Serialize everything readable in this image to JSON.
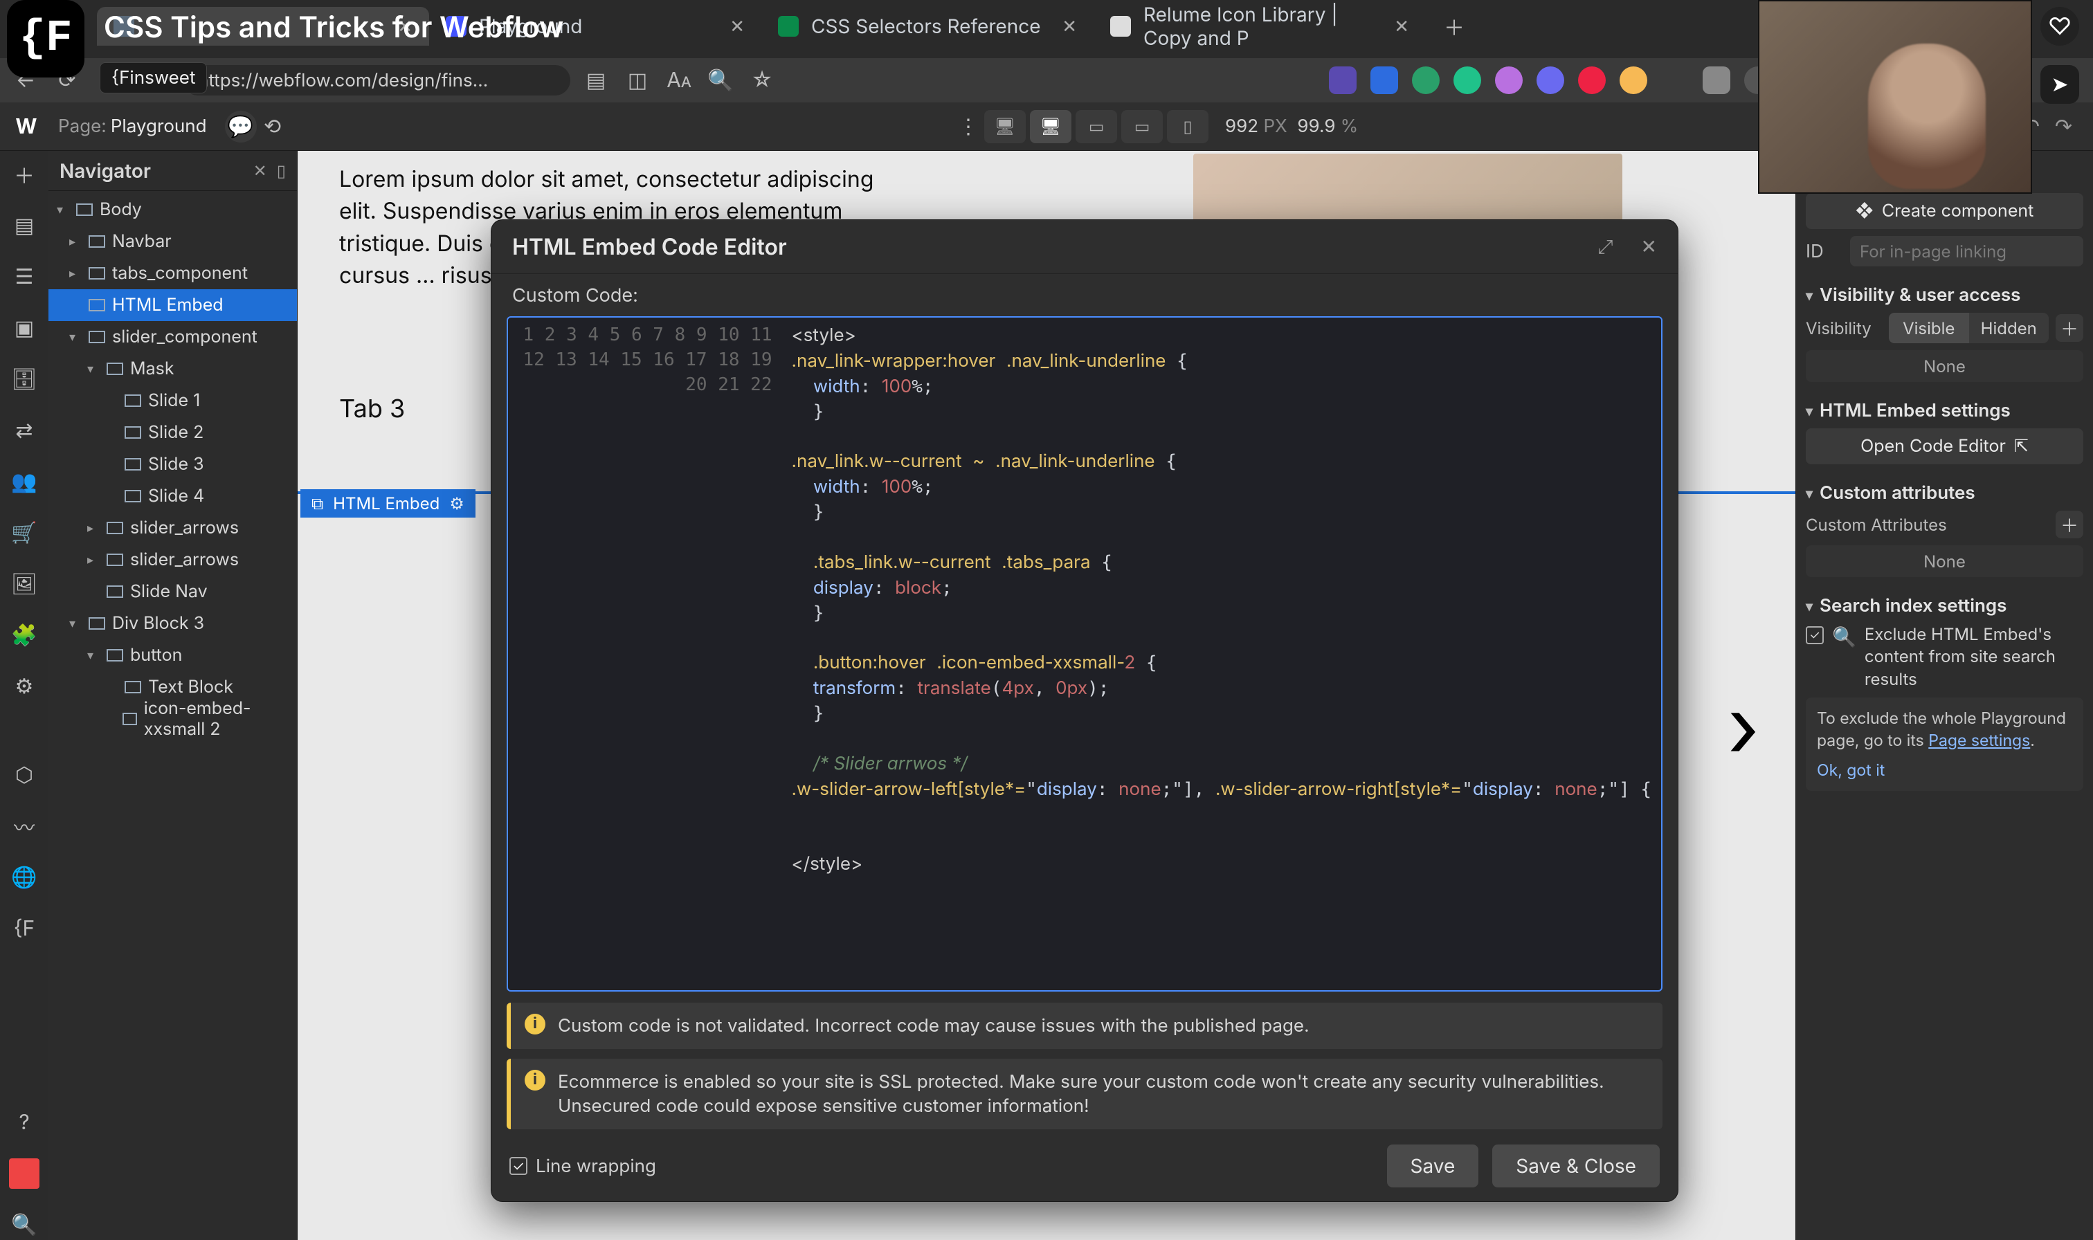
{
  "video_title": "CSS Tips and Tricks for Webflow",
  "fs_tooltip": "{Finsweet",
  "browser_tabs": [
    {
      "label": "",
      "active": false
    },
    {
      "label": "Playground",
      "active": false
    },
    {
      "label": "CSS Selectors Reference",
      "active": false
    },
    {
      "label": "Relume Icon Library | Copy and P",
      "active": false
    }
  ],
  "address_url": "https://webflow.com/design/fins…",
  "wf": {
    "page_label": "Page:",
    "page_name": "Playground",
    "px_value": "992",
    "px_unit": "PX",
    "zoom": "99.9",
    "zoom_unit": "%"
  },
  "navigator": {
    "title": "Navigator",
    "tree": [
      {
        "lvl": 0,
        "label": "Body",
        "caret": "▾"
      },
      {
        "lvl": 1,
        "label": "Navbar",
        "caret": "▸"
      },
      {
        "lvl": 1,
        "label": "tabs_component",
        "caret": "▸"
      },
      {
        "lvl": 1,
        "label": "HTML Embed",
        "caret": "",
        "sel": true
      },
      {
        "lvl": 1,
        "label": "slider_component",
        "caret": "▾"
      },
      {
        "lvl": 2,
        "label": "Mask",
        "caret": "▾"
      },
      {
        "lvl": 3,
        "label": "Slide 1",
        "caret": ""
      },
      {
        "lvl": 3,
        "label": "Slide 2",
        "caret": ""
      },
      {
        "lvl": 3,
        "label": "Slide 3",
        "caret": ""
      },
      {
        "lvl": 3,
        "label": "Slide 4",
        "caret": ""
      },
      {
        "lvl": 2,
        "label": "slider_arrows",
        "caret": "▸"
      },
      {
        "lvl": 2,
        "label": "slider_arrows",
        "caret": "▸"
      },
      {
        "lvl": 2,
        "label": "Slide Nav",
        "caret": ""
      },
      {
        "lvl": 1,
        "label": "Div Block 3",
        "caret": "▾"
      },
      {
        "lvl": 2,
        "label": "button",
        "caret": "▾"
      },
      {
        "lvl": 3,
        "label": "Text Block",
        "caret": ""
      },
      {
        "lvl": 3,
        "label": "icon-embed-xxsmall 2",
        "caret": ""
      }
    ]
  },
  "canvas": {
    "lorem": "Lorem ipsum dolor sit amet, consectetur adipiscing elit. Suspendisse varius enim in eros elementum tristique. Duis cursus, mi …\ncommodo …\njusto cursus …\nrisus tristique …",
    "tab3": "Tab 3",
    "embed_badge": "HTML Embed"
  },
  "modal": {
    "title": "HTML Embed Code Editor",
    "subtitle": "Custom Code:",
    "code_lines": [
      "<style>",
      ".nav_link-wrapper:hover .nav_link-underline {",
      "  width: 100%;",
      "  }",
      "",
      ".nav_link.w--current ~ .nav_link-underline {",
      "  width: 100%;",
      "  }",
      "",
      "  .tabs_link.w--current .tabs_para {",
      "  display: block;",
      "  }",
      "",
      "  .button:hover .icon-embed-xxsmall-2 {",
      "  transform: translate(4px, 0px);",
      "  }",
      "",
      "  /* Slider arrwos */",
      ".w-slider-arrow-left[style*=\"display: none;\"], .w-slider-arrow-right[style*=\"display: none;\"] {",
      "",
      "",
      "</style>"
    ],
    "warn1": "Custom code is not validated. Incorrect code may cause issues with the published page.",
    "warn2": "Ecommerce is enabled so your site is SSL protected. Make sure your custom code won't create any security vulnerabilities. Unsecured code could expose sensitive customer information!",
    "line_wrapping": "Line wrapping",
    "save": "Save",
    "save_close": "Save & Close"
  },
  "inspector": {
    "title": "HTML Embed Settings",
    "create_component": "Create component",
    "id_label": "ID",
    "id_placeholder": "For in-page linking",
    "section_visibility": "Visibility & user access",
    "vis_label": "Visibility",
    "vis_visible": "Visible",
    "vis_hidden": "Hidden",
    "none": "None",
    "section_embed": "HTML Embed settings",
    "open_code": "Open Code Editor",
    "section_attrs": "Custom attributes",
    "attrs_label": "Custom Attributes",
    "section_search": "Search index settings",
    "exclude_label": "Exclude HTML Embed's content from site search results",
    "tip_text_a": "To exclude the whole Playground page, go to its ",
    "tip_link": "Page settings",
    "tip_text_b": ".",
    "tip_ok": "Ok, got it"
  }
}
